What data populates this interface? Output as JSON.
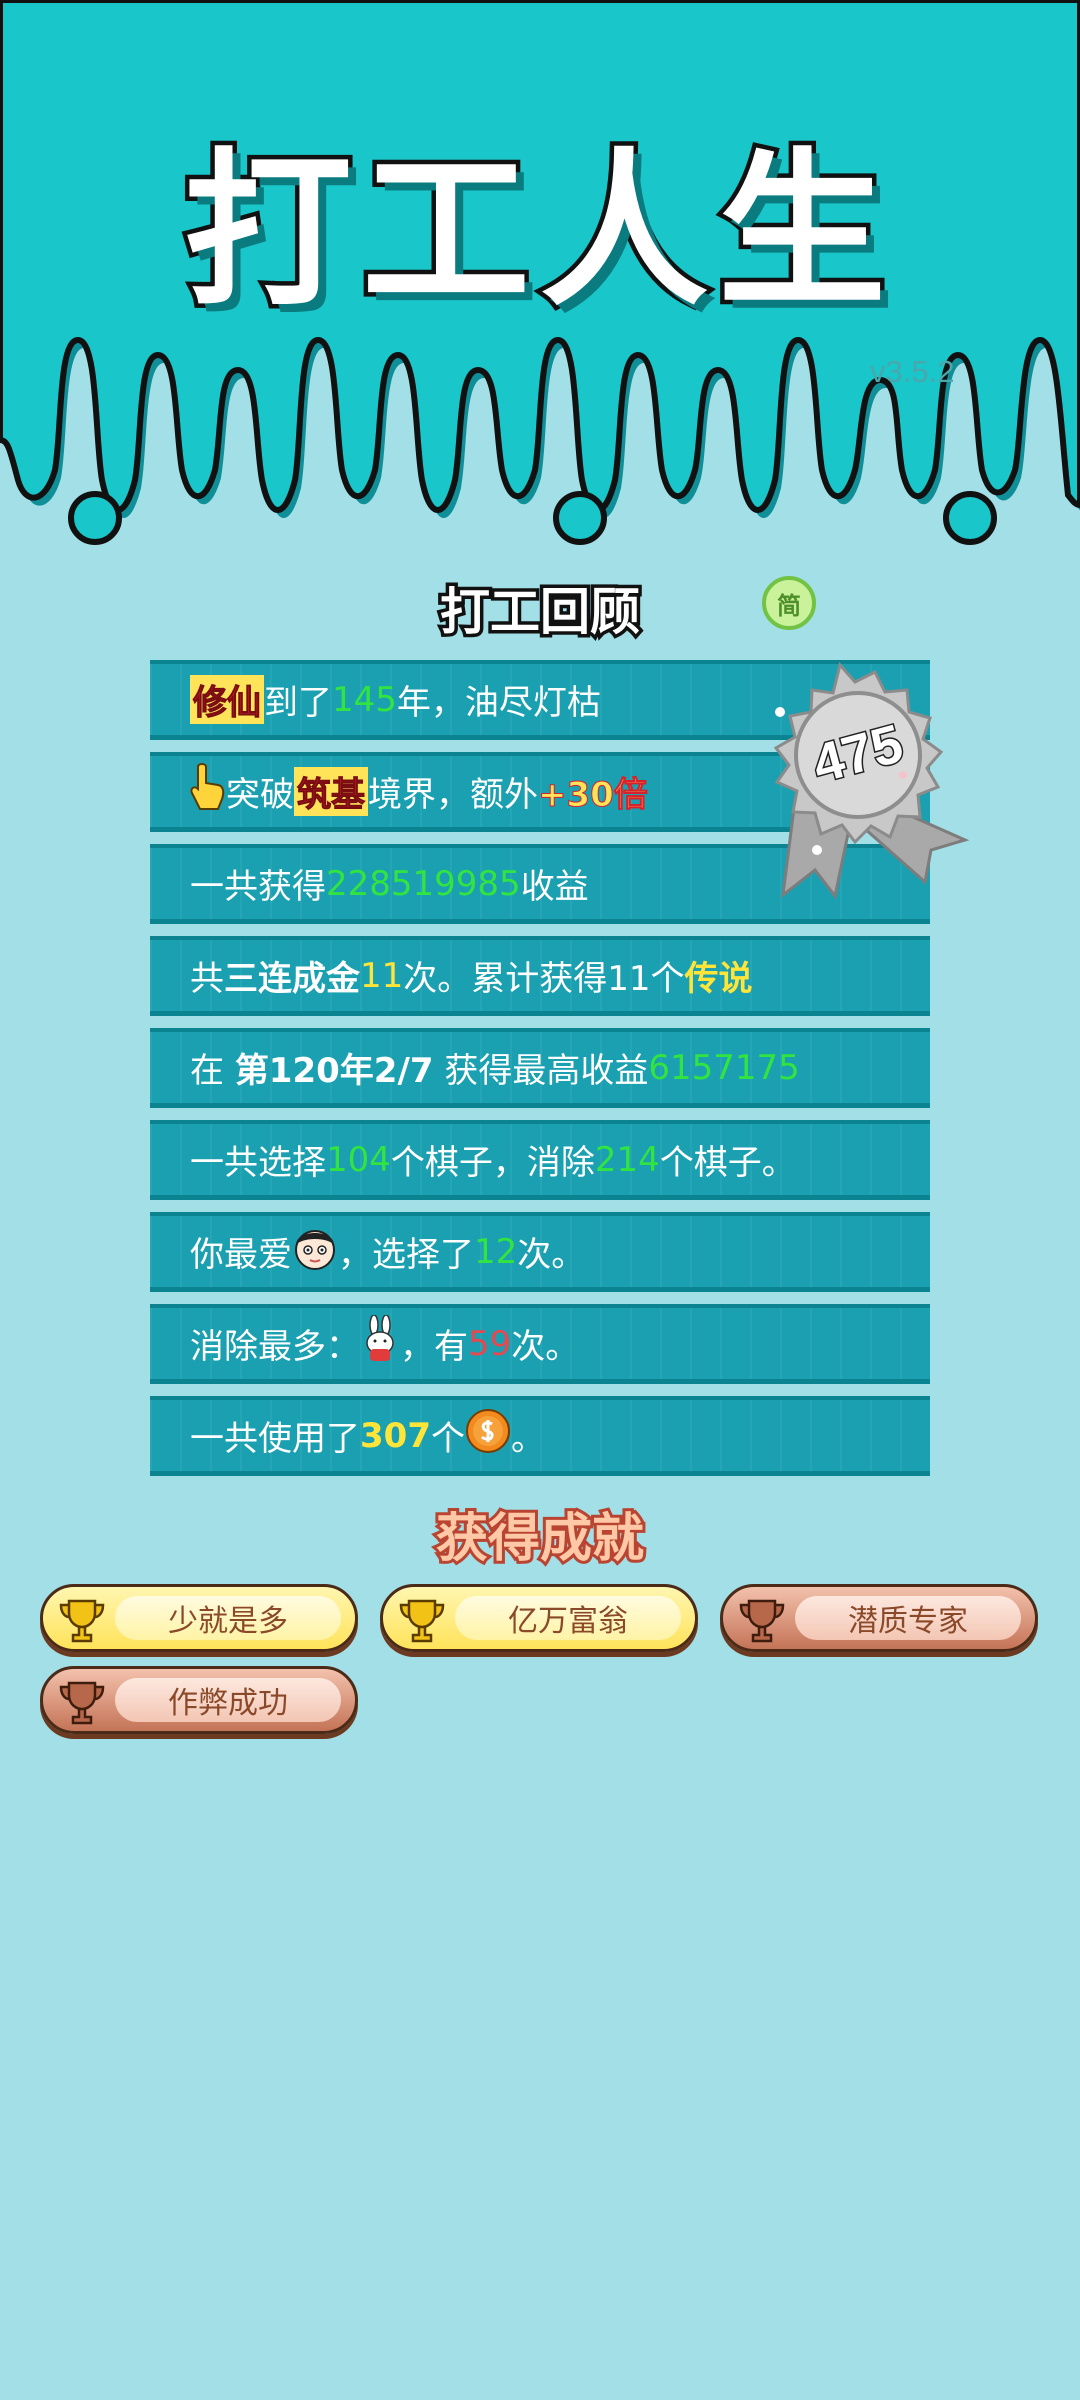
{
  "header": {
    "title": "打工人生",
    "version": "v3.5.2"
  },
  "review": {
    "title": "打工回顾",
    "lang_toggle": "简",
    "badge_score": "475",
    "rows": {
      "r1": {
        "a": "修仙",
        "b": "到了",
        "c": "145",
        "d": "年，油尽灯枯"
      },
      "r2": {
        "a": "突破",
        "b": "筑基",
        "c": "境界，额外",
        "d": "+30倍"
      },
      "r3": {
        "a": "一共获得",
        "b": "228519985",
        "c": "收益"
      },
      "r4": {
        "a": "共",
        "b": "三连成金",
        "c": "11",
        "d": "次。累计获得11个",
        "e": "传说"
      },
      "r5": {
        "a": "在 ",
        "b": "第120年2/7",
        "c": " 获得最高收益",
        "d": "6157175"
      },
      "r6": {
        "a": "一共选择",
        "b": "104",
        "c": "个棋子，消除",
        "d": "214",
        "e": "个棋子。"
      },
      "r7": {
        "a": "你最爱",
        "b": "，选择了",
        "c": "12",
        "d": "次。"
      },
      "r8": {
        "a": "消除最多：",
        "b": "，有",
        "c": "59",
        "d": "次。"
      },
      "r9": {
        "a": "一共使用了",
        "b": "307",
        "c": "个",
        "d": "。"
      }
    }
  },
  "achievements": {
    "title": "获得成就",
    "items": [
      {
        "label": "少就是多",
        "tier": "gold"
      },
      {
        "label": "亿万富翁",
        "tier": "gold"
      },
      {
        "label": "潜质专家",
        "tier": "bronze"
      },
      {
        "label": "作弊成功",
        "tier": "bronze"
      }
    ]
  },
  "icons": [
    "pointing-hand-icon",
    "face-avatar-icon",
    "rabbit-icon",
    "coin-icon",
    "trophy-icon",
    "medal-badge-icon"
  ],
  "colors": {
    "background": "#a2dfe6",
    "header": "#19c6c9",
    "row": "#1aa0b0",
    "green_value": "#31e440",
    "yellow_value": "#ffe53a",
    "red_value": "#e7474f"
  }
}
